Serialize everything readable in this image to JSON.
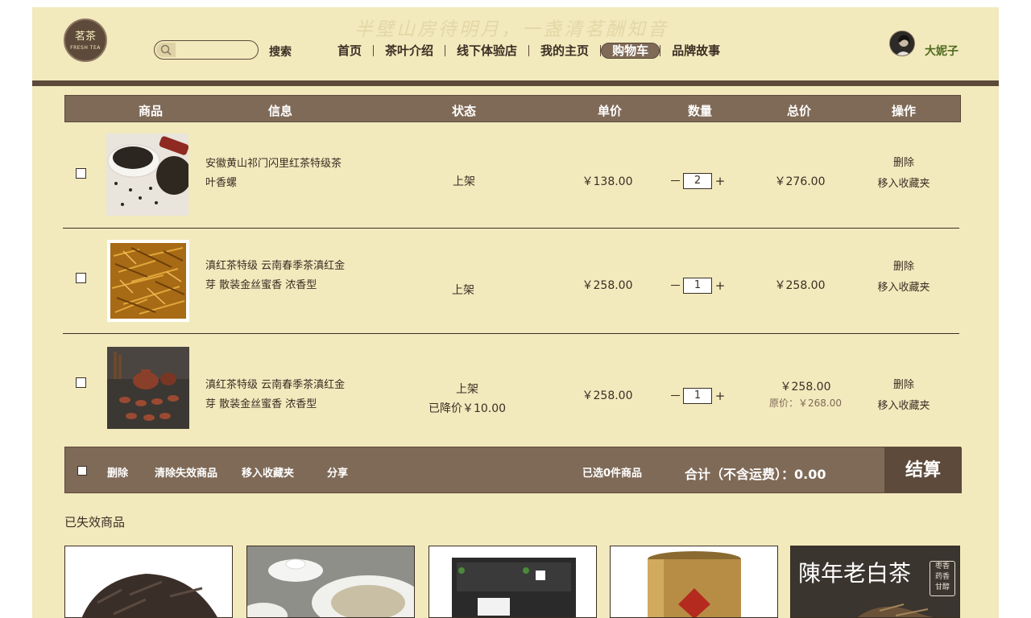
{
  "header": {
    "slogan": "半壁山房待明月，一盏清茗酬知音",
    "logo_text": "茗茶",
    "logo_sub": "FRESH TEA",
    "search_placeholder": "",
    "search_label": "搜索",
    "nav": [
      {
        "label": "首页"
      },
      {
        "label": "茶叶介绍"
      },
      {
        "label": "线下体验店"
      },
      {
        "label": "我的主页"
      },
      {
        "label": "购物车",
        "active": true
      },
      {
        "label": "品牌故事"
      }
    ],
    "username": "大妮子"
  },
  "cart": {
    "columns": [
      "商品",
      "信息",
      "状态",
      "单价",
      "数量",
      "总价",
      "操作"
    ],
    "rows": [
      {
        "name_line1": "安徽黄山祁门闪里红茶特级茶",
        "name_line2": "叶香螺",
        "status": "上架",
        "status_note": "",
        "price": "￥138.00",
        "qty": "2",
        "total": "￥276.00",
        "original_price": "",
        "op_delete": "删除",
        "op_favorite": "移入收藏夹"
      },
      {
        "name_line1": "滇红茶特级 云南春季茶滇红金",
        "name_line2": "芽 散装金丝蜜香 浓香型",
        "status": "上架",
        "status_note": "",
        "price": "￥258.00",
        "qty": "1",
        "total": "￥258.00",
        "original_price": "",
        "op_delete": "删除",
        "op_favorite": "移入收藏夹"
      },
      {
        "name_line1": "滇红茶特级 云南春季茶滇红金",
        "name_line2": "芽 散装金丝蜜香 浓香型",
        "status": "上架",
        "status_note": "已降价￥10.00",
        "price": "￥258.00",
        "qty": "1",
        "total": "￥258.00",
        "original_price": "原价：￥268.00",
        "op_delete": "删除",
        "op_favorite": "移入收藏夹"
      }
    ],
    "qty_minus": "－",
    "qty_plus": "+"
  },
  "footer_bar": {
    "delete": "删除",
    "clear_invalid": "清除失效商品",
    "move_favorite": "移入收藏夹",
    "share": "分享",
    "selected_count": "已选0件商品",
    "total": "合计（不含运费）：0.00",
    "checkout": "结算"
  },
  "invalid": {
    "title": "已失效商品",
    "tile5_text": "陳年老白茶",
    "tile5_tag": "枣香\n药香\n甘醇"
  },
  "colors": {
    "page_bg": "#f2e9bd",
    "brown_dark": "#5d4a3a",
    "brown_mid": "#7f6a57",
    "username_green": "#4f6b1e"
  }
}
